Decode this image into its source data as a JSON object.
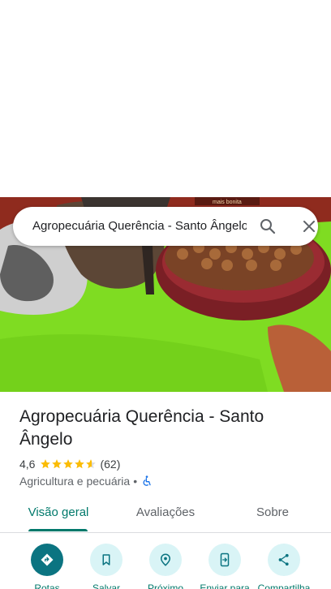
{
  "search": {
    "query": "Agropecuária Querência - Santo Ângelo",
    "search_icon": "search-icon",
    "close_icon": "close-icon"
  },
  "hero": {
    "image": "dog food bag photo",
    "brand_text": "mais bonita"
  },
  "place": {
    "title": "Agropecuária Querência - Santo Ângelo",
    "rating": "4,6",
    "rating_value": 4.6,
    "review_count": "(62)",
    "category": "Agricultura e pecuária",
    "separator": "•",
    "accessibility_icon": "wheelchair-icon"
  },
  "tabs": [
    {
      "label": "Visão geral",
      "active": true
    },
    {
      "label": "Avaliações",
      "active": false
    },
    {
      "label": "Sobre",
      "active": false
    }
  ],
  "actions": [
    {
      "label": "Rotas",
      "icon": "directions-icon"
    },
    {
      "label": "Salvar",
      "icon": "bookmark-icon"
    },
    {
      "label": "Próximo",
      "icon": "nearby-icon"
    },
    {
      "label": "Enviar para",
      "icon": "send-to-phone-icon"
    },
    {
      "label": "Compartilha",
      "icon": "share-icon"
    }
  ],
  "colors": {
    "accent": "#00796b",
    "action_bg": "#d9f4f6",
    "primary_action": "#0b7481",
    "star": "#fbbc04"
  }
}
